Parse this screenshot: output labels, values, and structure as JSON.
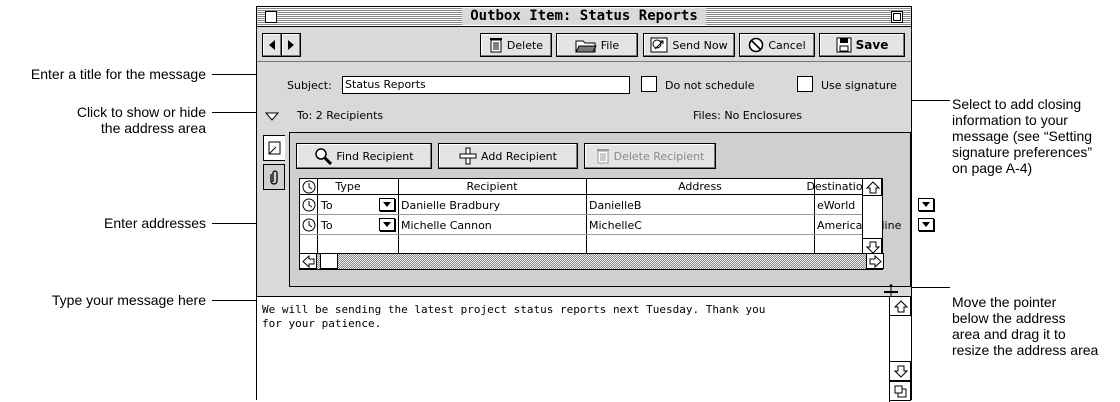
{
  "window": {
    "title": "Outbox Item: Status Reports"
  },
  "toolbar": {
    "delete_label": "Delete",
    "file_label": "File",
    "send_now_label": "Send Now",
    "cancel_label": "Cancel",
    "save_label": "Save"
  },
  "header": {
    "subject_label": "Subject:",
    "subject_value": "Status Reports",
    "do_not_schedule_label": "Do not schedule",
    "use_signature_label": "Use signature",
    "to_summary": "To: 2 Recipients",
    "files_summary": "Files: No Enclosures"
  },
  "address_toolbar": {
    "find_label": "Find Recipient",
    "add_label": "Add Recipient",
    "delete_label": "Delete Recipient"
  },
  "table": {
    "columns": [
      "Type",
      "Recipient",
      "Address",
      "Destination"
    ],
    "rows": [
      {
        "type": "To",
        "recipient": "Danielle Bradbury",
        "address": "DanielleB",
        "destination": "eWorld"
      },
      {
        "type": "To",
        "recipient": "Michelle Cannon",
        "address": "MichelleC",
        "destination": "America Online"
      }
    ]
  },
  "message": {
    "text": "We will be sending the latest project status reports next Tuesday. Thank you\nfor your patience."
  },
  "callouts": {
    "title": "Enter a title for the message",
    "toggle": "Click to show or hide\nthe address area",
    "addresses": "Enter addresses",
    "type": "Type your message here",
    "signature": "Select to add closing\ninformation to your\nmessage (see “Setting\nsignature preferences”\non page A-4)",
    "resize": "Move the pointer\nbelow the address\narea and drag it to\nresize the address area"
  }
}
